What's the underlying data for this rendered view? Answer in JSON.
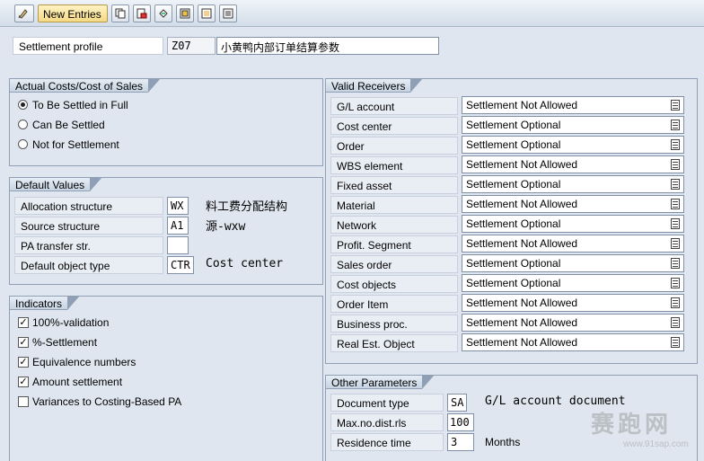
{
  "toolbar": {
    "new_entries_label": "New Entries",
    "icons": [
      "display-change-icon",
      "copy-icon",
      "delete-icon",
      "undo-icon",
      "select-all-icon",
      "select-block-icon",
      "deselect-all-icon"
    ]
  },
  "header": {
    "settlement_profile_label": "Settlement profile",
    "settlement_profile_code": "Z07",
    "settlement_profile_desc": "小黄鸭内部订单结算参数"
  },
  "actual_costs": {
    "title": "Actual Costs/Cost of Sales",
    "options": [
      {
        "label": "To Be Settled in Full",
        "selected": true
      },
      {
        "label": "Can Be Settled",
        "selected": false
      },
      {
        "label": "Not for Settlement",
        "selected": false
      }
    ]
  },
  "default_values": {
    "title": "Default Values",
    "rows": [
      {
        "label": "Allocation structure",
        "value": "WX",
        "text": "料工费分配结构"
      },
      {
        "label": "Source structure",
        "value": "A1",
        "text": "源-wxw"
      },
      {
        "label": "PA transfer str.",
        "value": "",
        "text": ""
      },
      {
        "label": "Default object type",
        "value": "CTR",
        "text": "Cost center"
      }
    ]
  },
  "indicators": {
    "title": "Indicators",
    "items": [
      {
        "label": "100%-validation",
        "checked": true
      },
      {
        "label": "%-Settlement",
        "checked": true
      },
      {
        "label": "Equivalence numbers",
        "checked": true
      },
      {
        "label": "Amount settlement",
        "checked": true
      },
      {
        "label": "Variances to Costing-Based PA",
        "checked": false
      }
    ]
  },
  "valid_receivers": {
    "title": "Valid Receivers",
    "rows": [
      {
        "label": "G/L account",
        "value": "Settlement Not Allowed"
      },
      {
        "label": "Cost center",
        "value": "Settlement Optional"
      },
      {
        "label": "Order",
        "value": "Settlement Optional"
      },
      {
        "label": "WBS element",
        "value": "Settlement Not Allowed"
      },
      {
        "label": "Fixed asset",
        "value": "Settlement Optional"
      },
      {
        "label": "Material",
        "value": "Settlement Not Allowed"
      },
      {
        "label": "Network",
        "value": "Settlement Optional"
      },
      {
        "label": "Profit. Segment",
        "value": "Settlement Not Allowed"
      },
      {
        "label": "Sales order",
        "value": "Settlement Optional"
      },
      {
        "label": "Cost objects",
        "value": "Settlement Optional"
      },
      {
        "label": "Order Item",
        "value": "Settlement Not Allowed"
      },
      {
        "label": "Business proc.",
        "value": "Settlement Not Allowed"
      },
      {
        "label": "Real Est. Object",
        "value": "Settlement Not Allowed"
      }
    ]
  },
  "other_parameters": {
    "title": "Other Parameters",
    "document_type_label": "Document type",
    "document_type_value": "SA",
    "document_type_text": "G/L account document",
    "max_dist_label": "Max.no.dist.rls",
    "max_dist_value": "100",
    "residence_label": "Residence time",
    "residence_value": "3",
    "residence_unit": "Months"
  },
  "watermark": {
    "text": "赛跑网",
    "url": "www.91sap.com"
  }
}
